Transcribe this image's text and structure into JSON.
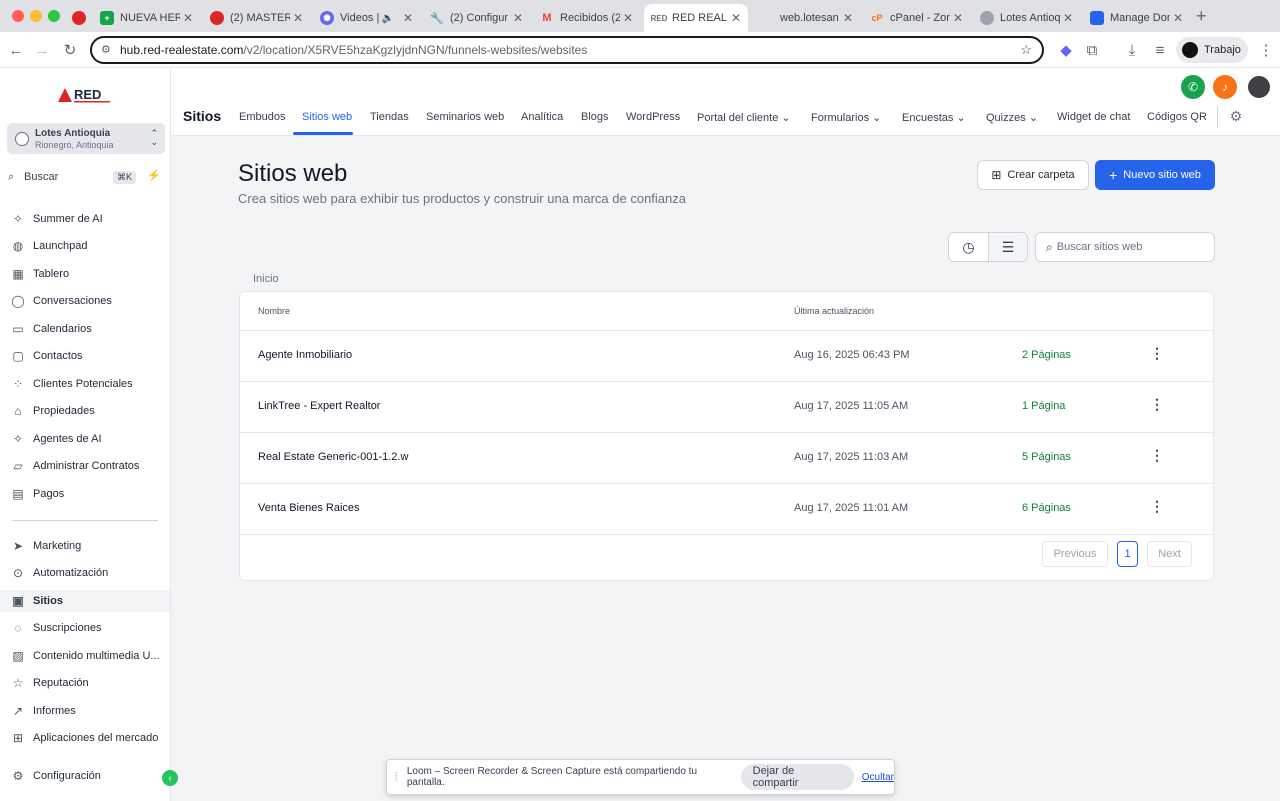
{
  "browser": {
    "tabs": [
      {
        "title": "NUEVA HERR",
        "favicon": "sheets-icon",
        "color": "#16a34a",
        "active": false
      },
      {
        "title": "(2) MASTER",
        "favicon": "record-icon",
        "color": "#dc2626",
        "active": false
      },
      {
        "title": "Videos |",
        "favicon": "atom-icon",
        "color": "#6366f1",
        "active": false,
        "audio": true
      },
      {
        "title": "(2) Configur",
        "favicon": "tool-icon",
        "color": "#6b7280",
        "active": false
      },
      {
        "title": "Recibidos (2",
        "favicon": "gmail-icon",
        "color": "#ea4335",
        "active": false
      },
      {
        "title": "RED REAL E",
        "favicon": "red-logo-icon",
        "color": "#6b7280",
        "active": true
      },
      {
        "title": "web.lotesan",
        "favicon": "globe-icon",
        "color": "#9ca3af",
        "active": false
      },
      {
        "title": "cPanel - Zon",
        "favicon": "cpanel-icon",
        "color": "#f97316",
        "active": false
      },
      {
        "title": "Lotes Antioq",
        "favicon": "lotes-icon",
        "color": "#6b7280",
        "active": false
      },
      {
        "title": "Manage Don",
        "favicon": "manage-icon",
        "color": "#2563eb",
        "active": false
      }
    ],
    "url_host": "hub.red-realestate.com",
    "url_path": "/v2/location/X5RVE5hzaKgzlyjdnNGN/funnels-websites/websites",
    "profile_label": "Trabajo"
  },
  "sidebar": {
    "location_name": "Lotes Antioquia",
    "location_sub": "Rionegro, Antioquia",
    "search_label": "Buscar",
    "search_shortcut": "⌘K",
    "items": [
      {
        "label": "Summer de AI",
        "icon": "sparkle-icon"
      },
      {
        "label": "Launchpad",
        "icon": "launchpad-icon"
      },
      {
        "label": "Tablero",
        "icon": "dashboard-icon"
      },
      {
        "label": "Conversaciones",
        "icon": "chat-icon"
      },
      {
        "label": "Calendarios",
        "icon": "calendar-icon"
      },
      {
        "label": "Contactos",
        "icon": "contacts-icon"
      },
      {
        "label": "Clientes Potenciales",
        "icon": "leads-icon"
      },
      {
        "label": "Propiedades",
        "icon": "home-icon"
      },
      {
        "label": "Agentes de AI",
        "icon": "sparkle-icon"
      },
      {
        "label": "Administrar Contratos",
        "icon": "folder-icon"
      },
      {
        "label": "Pagos",
        "icon": "receipt-icon"
      },
      {
        "label": "Marketing",
        "icon": "send-icon"
      },
      {
        "label": "Automatización",
        "icon": "automation-icon"
      },
      {
        "label": "Sitios",
        "icon": "sites-icon"
      },
      {
        "label": "Suscripciones",
        "icon": "subscriptions-icon"
      },
      {
        "label": "Contenido multimedia U...",
        "icon": "media-icon"
      },
      {
        "label": "Reputación",
        "icon": "star-icon"
      },
      {
        "label": "Informes",
        "icon": "chart-icon"
      },
      {
        "label": "Aplicaciones del mercado",
        "icon": "apps-icon"
      },
      {
        "label": "Configuración",
        "icon": "gear-icon"
      }
    ]
  },
  "topnav": {
    "section_title": "Sitios",
    "items": [
      {
        "label": "Embudos"
      },
      {
        "label": "Sitios web"
      },
      {
        "label": "Tiendas"
      },
      {
        "label": "Seminarios web"
      },
      {
        "label": "Analítica"
      },
      {
        "label": "Blogs"
      },
      {
        "label": "WordPress"
      },
      {
        "label": "Portal del cliente"
      },
      {
        "label": "Formularios"
      },
      {
        "label": "Encuestas"
      },
      {
        "label": "Quizzes"
      },
      {
        "label": "Widget de chat"
      },
      {
        "label": "Códigos QR"
      }
    ]
  },
  "page": {
    "title": "Sitios web",
    "subtitle": "Crea sitios web para exhibir tus productos y construir una marca de confianza",
    "create_folder_label": "Crear carpeta",
    "new_site_label": "Nuevo sitio web",
    "search_placeholder": "Buscar sitios web",
    "breadcrumb": "Inicio",
    "table": {
      "col_name": "Nombre",
      "col_updated": "Última actualización",
      "rows": [
        {
          "name": "Agente Inmobiliario",
          "updated": "Aug 16, 2025 06:43 PM",
          "pages": "2 Páginas"
        },
        {
          "name": "LinkTree - Expert Realtor",
          "updated": "Aug 17, 2025 11:05 AM",
          "pages": "1 Página"
        },
        {
          "name": "Real Estate Generic-001-1.2.w",
          "updated": "Aug 17, 2025 11:03 AM",
          "pages": "5 Páginas"
        },
        {
          "name": "Venta Bienes Raices",
          "updated": "Aug 17, 2025 11:01 AM",
          "pages": "6 Páginas"
        }
      ]
    },
    "pagination": {
      "prev": "Previous",
      "current": "1",
      "next": "Next"
    }
  },
  "loom": {
    "message": "Loom – Screen Recorder & Screen Capture está compartiendo tu pantalla.",
    "stop_label": "Dejar de compartir",
    "hide_label": "Ocultar"
  },
  "colors": {
    "accent": "#2563eb",
    "success": "#15803d",
    "brand_red": "#dc2626"
  }
}
